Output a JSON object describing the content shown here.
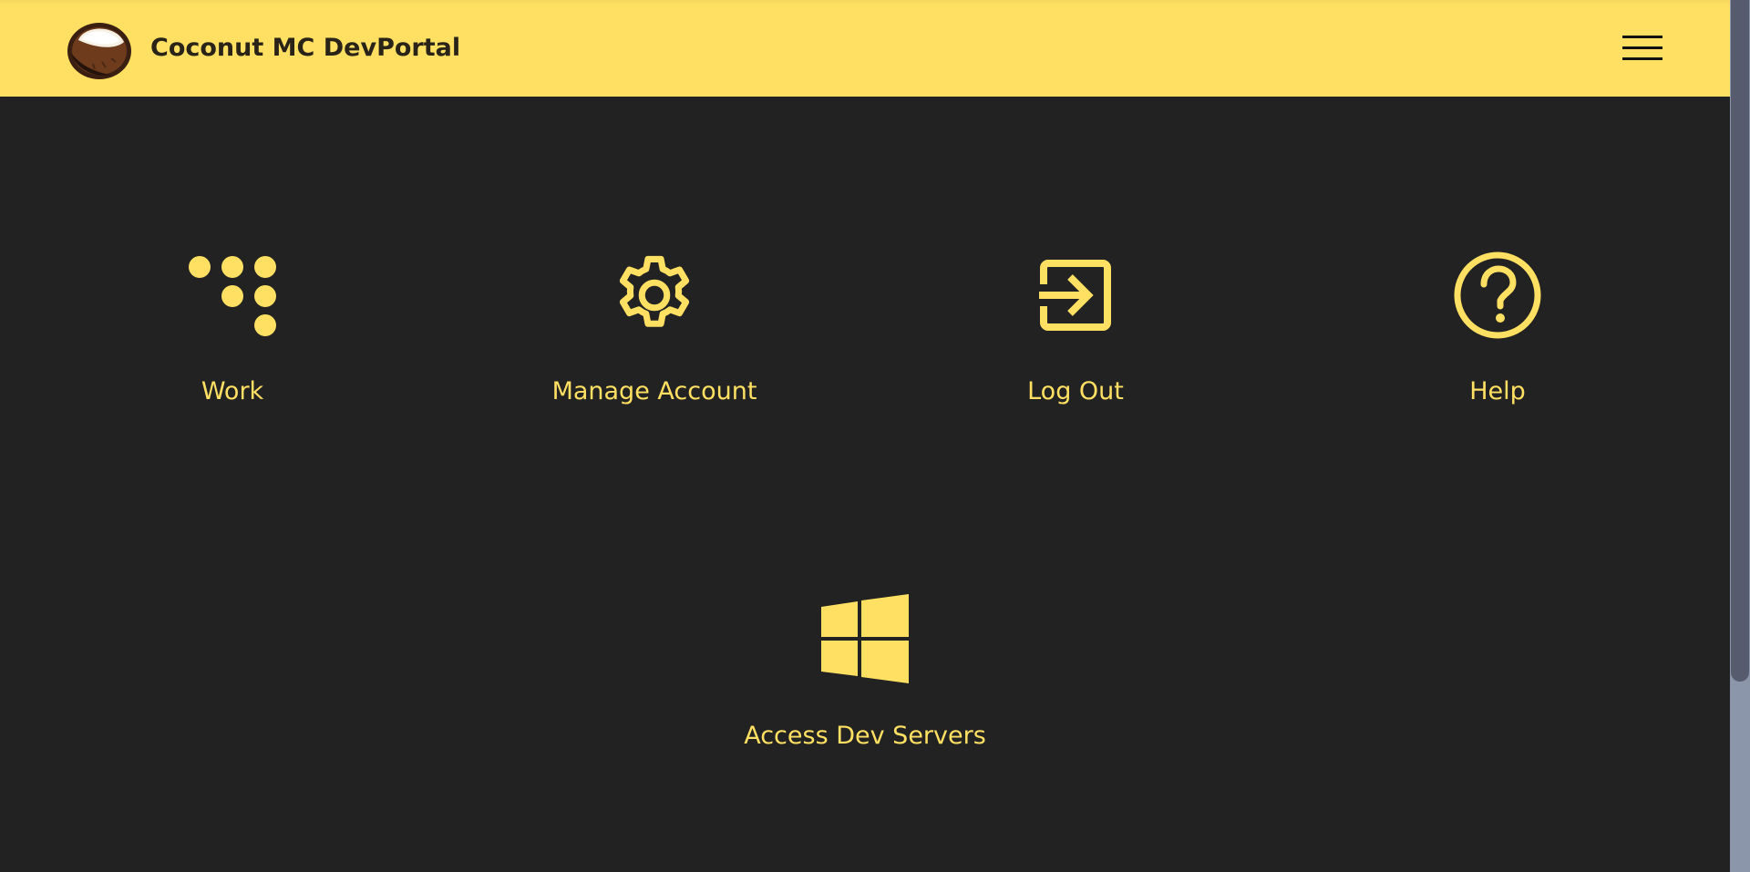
{
  "header": {
    "brand_title": "Coconut MC DevPortal",
    "logo": "coconut-logo",
    "menu_icon": "hamburger-menu-icon"
  },
  "tiles": [
    {
      "label": "Work",
      "icon": "dots-triangle-icon"
    },
    {
      "label": "Manage Account",
      "icon": "gear-icon"
    },
    {
      "label": "Log Out",
      "icon": "log-out-icon"
    },
    {
      "label": "Help",
      "icon": "question-circle-icon"
    },
    {
      "label": "Access Dev Servers",
      "icon": "windows-icon"
    }
  ],
  "colors": {
    "accent": "#ffe062",
    "background": "#222222",
    "header_text": "#2a2418",
    "scroll_track": "#8b96ab",
    "scroll_thumb": "#565c6d"
  }
}
